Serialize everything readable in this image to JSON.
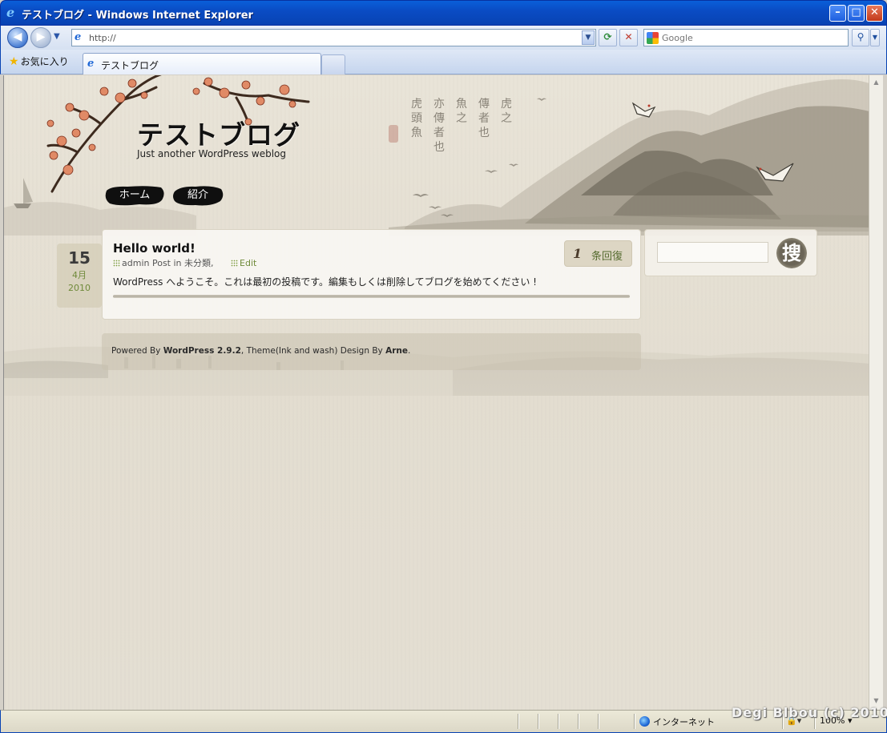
{
  "window": {
    "title": "テストブログ - Windows Internet Explorer"
  },
  "addressbar": {
    "url": "http://",
    "search_placeholder": "Google"
  },
  "favorites": {
    "label": "お気に入り"
  },
  "tabs": [
    {
      "label": "テストブログ",
      "active": true
    }
  ],
  "blog": {
    "title": "テストブログ",
    "tagline": "Just another WordPress weblog",
    "menu": [
      {
        "label": "ホーム"
      },
      {
        "label": "紹介"
      }
    ]
  },
  "post": {
    "day": "15",
    "month": "4月",
    "year": "2010",
    "title": "Hello world!",
    "author": "admin",
    "post_in": "Post in",
    "category": "未分類",
    "edit_label": "Edit",
    "body": "WordPress へようこそ。これは最初の投稿です。編集もしくは削除してブログを始めてください !",
    "comment_count": "1",
    "comment_label": "条回復"
  },
  "sidebar": {
    "search_button": "搜"
  },
  "footer": {
    "powered_by": "Powered By",
    "wordpress": "WordPress 2.9.2",
    "theme": ", Theme(Ink and wash) Design By",
    "designer": "Arne",
    "end": "."
  },
  "statusbar": {
    "zone": "インターネット",
    "zoom": "100%"
  },
  "watermark": "Degi Blbou (c) 2010",
  "colors": {
    "titlebar": "#0a4cc4",
    "page_bg": "#e7e2d6",
    "link_green": "#6f8a3a"
  }
}
